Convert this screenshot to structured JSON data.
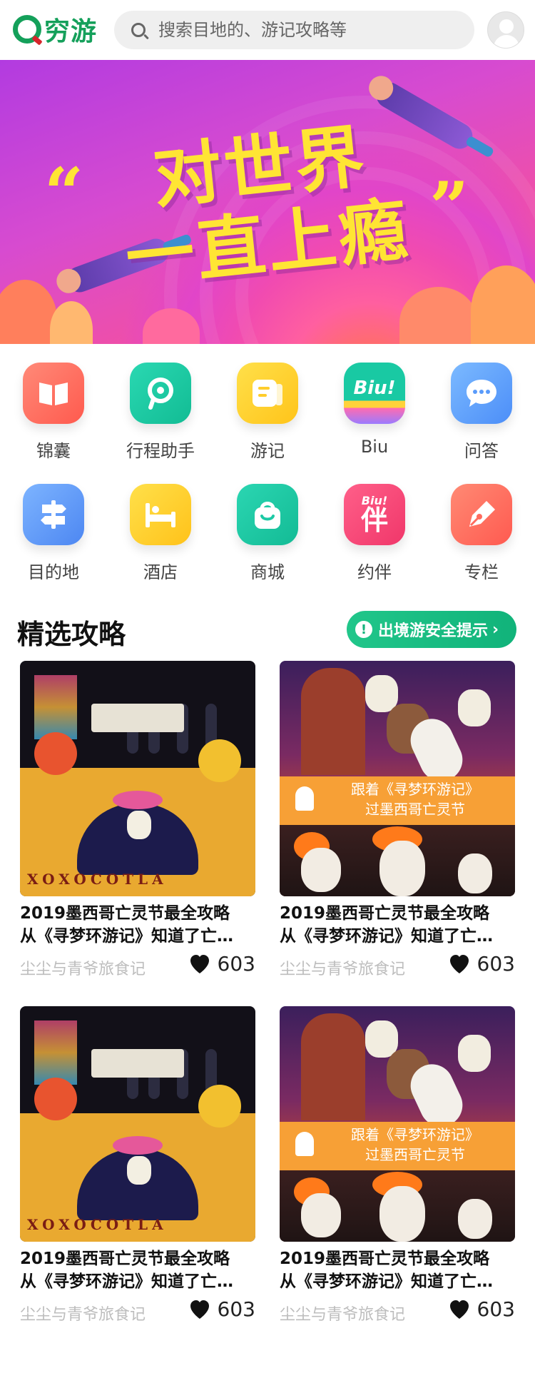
{
  "header": {
    "logo_text": "穷游",
    "search_placeholder": "搜索目地的、游记攻略等"
  },
  "banner": {
    "headline_line1": "对世界",
    "headline_line2": "一直上瘾",
    "quote_open": "“",
    "quote_close": "”"
  },
  "categories": [
    {
      "label": "锦囊",
      "icon": "book-icon",
      "color": "#ff6b5e"
    },
    {
      "label": "行程助手",
      "icon": "location-pin-icon",
      "color": "#1cc9a5"
    },
    {
      "label": "游记",
      "icon": "note-icon",
      "color": "#ffd02e"
    },
    {
      "label": "Biu",
      "icon": "biu-icon",
      "color": "#17c9a0"
    },
    {
      "label": "问答",
      "icon": "chat-bubble-icon",
      "color": "#5aa6ff"
    },
    {
      "label": "目的地",
      "icon": "signpost-icon",
      "color": "#5b9cff"
    },
    {
      "label": "酒店",
      "icon": "bed-icon",
      "color": "#ffd12b"
    },
    {
      "label": "商城",
      "icon": "shopping-bag-icon",
      "color": "#1cc9a5"
    },
    {
      "label": "约伴",
      "icon": "companion-icon",
      "color": "#ff4d7a"
    },
    {
      "label": "专栏",
      "icon": "pen-nib-icon",
      "color": "#ff6b5e"
    }
  ],
  "biu_glyph": "Biu!",
  "companion_glyph": "伴",
  "section": {
    "title": "精选攻略",
    "safety_button": "出境游安全提示",
    "safety_icon": "!",
    "chevron": "›"
  },
  "articles": [
    {
      "title_line1": "2019墨西哥亡灵节最全攻略",
      "title_line2": "从《寻梦环游记》知道了亡…",
      "author": "尘尘与青爷旅食记",
      "likes": "603",
      "image": "altar"
    },
    {
      "title_line1": "2019墨西哥亡灵节最全攻略",
      "title_line2": "从《寻梦环游记》知道了亡…",
      "author": "尘尘与青爷旅食记",
      "likes": "603",
      "image": "coco"
    },
    {
      "title_line1": "2019墨西哥亡灵节最全攻略",
      "title_line2": "从《寻梦环游记》知道了亡…",
      "author": "尘尘与青爷旅食记",
      "likes": "603",
      "image": "altar"
    },
    {
      "title_line1": "2019墨西哥亡灵节最全攻略",
      "title_line2": "从《寻梦环游记》知道了亡…",
      "author": "尘尘与青爷旅食记",
      "likes": "603",
      "image": "coco"
    }
  ],
  "coco_strip_line1": "跟着《寻梦环游记》",
  "coco_strip_line2": "过墨西哥亡灵节",
  "altar_lettering": "XOXOCOTLA"
}
